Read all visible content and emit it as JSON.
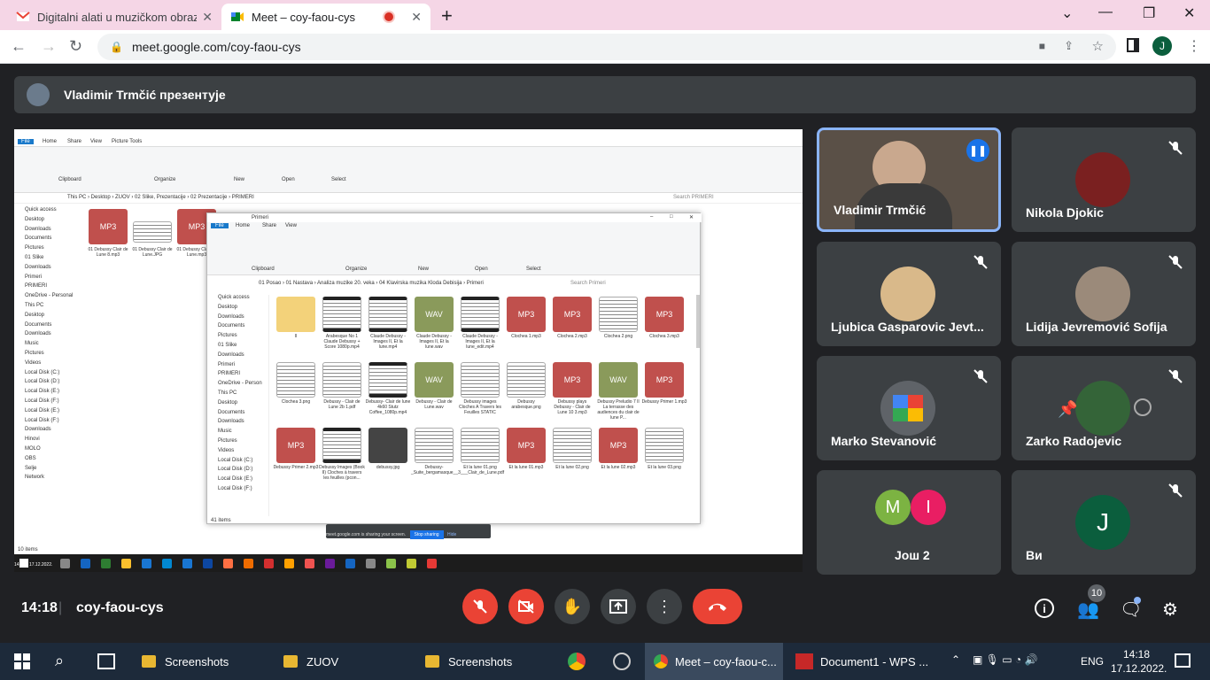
{
  "browser": {
    "tabs": [
      {
        "title": "Digitalni alati u muzičkom obrazo",
        "icon": "gmail-icon"
      },
      {
        "title": "Meet – coy-faou-cys",
        "icon": "meet-icon"
      }
    ],
    "url": "meet.google.com/coy-faou-cys"
  },
  "meet": {
    "presenter_text": "Vladimir Trmčić презентује",
    "meeting_code": "coy-faou-cys",
    "time": "14:18",
    "participants": [
      {
        "name": "Vladimir Trmčić",
        "speaking": true
      },
      {
        "name": "Nikola Djokic",
        "muted": true
      },
      {
        "name": "Ljubica Gasparovic Jevt...",
        "muted": true
      },
      {
        "name": "Lidija Jevremović Sofija",
        "muted": true
      },
      {
        "name": "Marko Stevanović",
        "muted": true
      },
      {
        "name": "Zarko Radojevic",
        "muted": true
      },
      {
        "name": "Још 2",
        "initials": [
          "M",
          "I"
        ]
      },
      {
        "name": "Ви",
        "initial": "J",
        "muted": true
      }
    ],
    "people_count": "10"
  },
  "shared_screen": {
    "back_window": {
      "path": "This PC › Desktop › ZUOV › 02 Slike, Prezentacije › 02 Prezentacije › PRIMERI",
      "search": "Search PRIMERI",
      "tabs": [
        "File",
        "Home",
        "Share",
        "View",
        "Picture Tools"
      ],
      "ribbon_groups": [
        "Clipboard",
        "Organize",
        "New",
        "Open",
        "Select"
      ],
      "files": [
        {
          "label": "MP3",
          "name": "01 Debussy  Clair de Lune 8.mp3"
        },
        {
          "label": "",
          "name": "01 Debussy  Clair de Lune.JPG"
        },
        {
          "label": "MP3",
          "name": "01 Debussy Clair de Lune.mp3"
        }
      ],
      "sidebar": [
        "Quick access",
        "Desktop",
        "Downloads",
        "Documents",
        "Pictures",
        "01 Slike",
        "Downloads",
        "Primeri",
        "PRIMERI",
        "OneDrive - Personal",
        "This PC",
        "Desktop",
        "Documents",
        "Downloads",
        "Music",
        "Pictures",
        "Videos",
        "Local Disk (C:)",
        "Local Disk (D:)",
        "Local Disk (E:)",
        "Local Disk (F:)",
        "Local Disk (E:)",
        "Local Disk (F:)",
        "Downloads",
        "Hinovi",
        "MOLO",
        "OBS",
        "Selje",
        "Network"
      ],
      "items_count": "10 items"
    },
    "front_window": {
      "title": "Primeri",
      "path": "01 Posao › 01 Nastava › Analiza muzike 20. veka › 04 Klavirska muzika Kloda Debisija › Primeri",
      "search": "Search Primeri",
      "tabs": [
        "File",
        "Home",
        "Share",
        "View"
      ],
      "ribbon_groups": [
        "Clipboard",
        "Organize",
        "New",
        "Open",
        "Select"
      ],
      "items_count": "41 items",
      "sidebar": [
        "Quick access",
        "Desktop",
        "Downloads",
        "Documents",
        "Pictures",
        "01 Slike",
        "Downloads",
        "Primeri",
        "PRIMERI",
        "OneDrive - Person",
        "This PC",
        "Desktop",
        "Documents",
        "Downloads",
        "Music",
        "Pictures",
        "Videos",
        "Local Disk (C:)",
        "Local Disk (D:)",
        "Local Disk (E:)",
        "Local Disk (F:)"
      ],
      "files": [
        {
          "type": "folder",
          "label": "",
          "name": "II"
        },
        {
          "type": "video",
          "label": "",
          "name": "Arabesque No 1 Claude Debussy + Score 1080p.mp4"
        },
        {
          "type": "video",
          "label": "",
          "name": "Claude Debussy - Images II, Et la lune.mp4"
        },
        {
          "type": "wav",
          "label": "WAV",
          "name": "Claude Debussy - Images II, Et la lune.wav"
        },
        {
          "type": "video",
          "label": "",
          "name": "Claude Debussy - Images II, Et la lune_edit.mp4"
        },
        {
          "type": "mp3",
          "label": "MP3",
          "name": "Clochea 1.mp3"
        },
        {
          "type": "mp3",
          "label": "MP3",
          "name": "Clochea 2.mp3"
        },
        {
          "type": "img",
          "label": "",
          "name": "Clochea 2.png"
        },
        {
          "type": "mp3",
          "label": "MP3",
          "name": "Clochea 3.mp3"
        },
        {
          "type": "img",
          "label": "",
          "name": "Clochea 3.png"
        },
        {
          "type": "pdf",
          "label": "",
          "name": "Debussy - Clair de Lune 2b 1.pdf"
        },
        {
          "type": "video",
          "label": "",
          "name": "Debussy- Clair de lune 4k60 Stutz Coffee_1080p.mp4"
        },
        {
          "type": "wav",
          "label": "WAV",
          "name": "Debussy - Clair de Lune.wav"
        },
        {
          "type": "img",
          "label": "",
          "name": "Debussy images Cloches A Travers les Feuilles STATIC"
        },
        {
          "type": "img",
          "label": "",
          "name": "Debussy arabesque.png"
        },
        {
          "type": "mp3",
          "label": "MP3",
          "name": "Debussy plays Debussy - Clair de Lune 10 3.mp3"
        },
        {
          "type": "wav",
          "label": "WAV",
          "name": "Debussy Preludio 7 Il La terrasse des audiences du clair de lune P..."
        },
        {
          "type": "mp3",
          "label": "MP3",
          "name": "Debussy Primer 1.mp3"
        },
        {
          "type": "mp3",
          "label": "MP3",
          "name": "Debussy Primer 2.mp3"
        },
        {
          "type": "video",
          "label": "",
          "name": "Debussy Images (Book II) Cloches à travers les feuilles (pcon..."
        },
        {
          "type": "photo",
          "label": "",
          "name": "debussy.jpg"
        },
        {
          "type": "pdf",
          "label": "",
          "name": "Debussy-_Suite_bergamasque__3___Clair_de_Lune.pdf"
        },
        {
          "type": "img",
          "label": "",
          "name": "Et la lune 01.png"
        },
        {
          "type": "mp3",
          "label": "MP3",
          "name": "Et la lune 01.mp3"
        },
        {
          "type": "img",
          "label": "",
          "name": "Et la lune 02.png"
        },
        {
          "type": "mp3",
          "label": "MP3",
          "name": "Et la lune 02.mp3"
        },
        {
          "type": "img",
          "label": "",
          "name": "Et la lune 03.png"
        }
      ]
    },
    "sharing_bar": {
      "text": "meet.google.com is sharing your screen.",
      "stop": "Stop sharing",
      "hide": "Hide"
    },
    "inner_clock": {
      "time": "14:18",
      "date": "17.12.2022."
    }
  },
  "taskbar": {
    "items": [
      "Screenshots",
      "ZUOV",
      "Screenshots",
      "Meet – coy-faou-c...",
      "Document1 - WPS ..."
    ],
    "lang": "ENG",
    "time": "14:18",
    "date": "17.12.2022."
  },
  "colors": {
    "meet_bg": "#202124",
    "tile": "#3c4043",
    "red": "#ea4335",
    "speaking_border": "#8ab4f8",
    "tabbar": "#f5d6e6"
  }
}
